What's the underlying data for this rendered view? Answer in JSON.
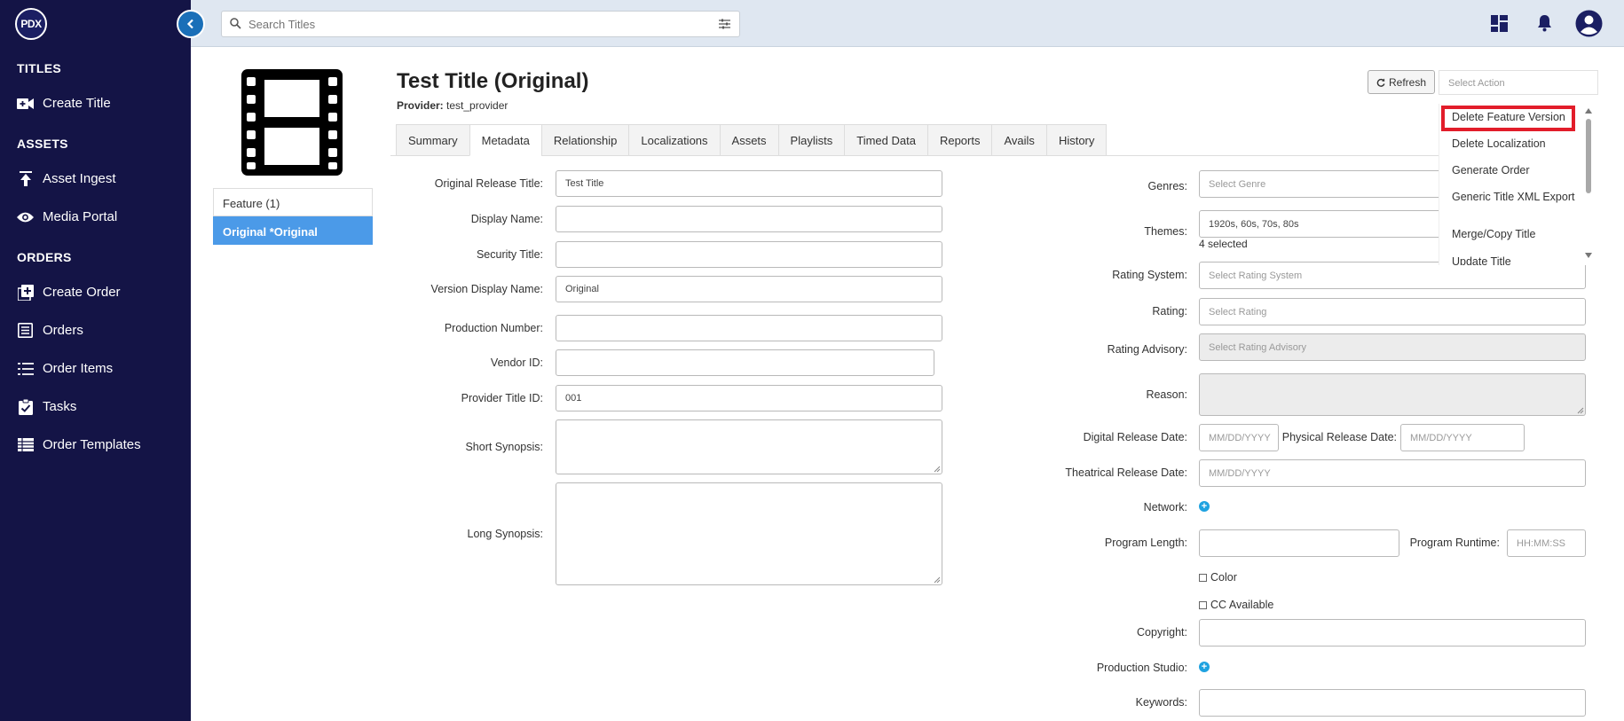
{
  "logo": "PDX",
  "sidebar": {
    "sections": [
      {
        "title": "TITLES",
        "items": [
          {
            "label": "Create Title",
            "icon": "video-add-icon"
          }
        ]
      },
      {
        "title": "ASSETS",
        "items": [
          {
            "label": "Asset Ingest",
            "icon": "upload-icon"
          },
          {
            "label": "Media Portal",
            "icon": "eye-icon"
          }
        ]
      },
      {
        "title": "ORDERS",
        "items": [
          {
            "label": "Create Order",
            "icon": "add-box-icon"
          },
          {
            "label": "Orders",
            "icon": "list-box-icon"
          },
          {
            "label": "Order Items",
            "icon": "list-icon"
          },
          {
            "label": "Tasks",
            "icon": "clipboard-check-icon"
          },
          {
            "label": "Order Templates",
            "icon": "table-icon"
          }
        ]
      }
    ]
  },
  "topbar": {
    "search_placeholder": "Search Titles"
  },
  "title": {
    "name": "Test Title (Original)",
    "provider_label": "Provider:",
    "provider_value": "test_provider"
  },
  "actions": {
    "refresh_label": "Refresh",
    "select_placeholder": "Select Action",
    "menu": [
      "Delete Feature Version",
      "Delete Localization",
      "Generate Order",
      "Generic Title XML Export",
      "Merge/Copy Title",
      "Update Title"
    ]
  },
  "versions": [
    {
      "label": "Feature (1)"
    },
    {
      "label": "Original *Original"
    }
  ],
  "tabs": [
    "Summary",
    "Metadata",
    "Relationship",
    "Localizations",
    "Assets",
    "Playlists",
    "Timed Data",
    "Reports",
    "Avails",
    "History"
  ],
  "active_tab": "Metadata",
  "left_form": {
    "original_release_title": {
      "label": "Original Release Title:",
      "value": "Test Title"
    },
    "display_name": {
      "label": "Display Name:",
      "value": ""
    },
    "security_title": {
      "label": "Security Title:",
      "value": ""
    },
    "version_display_name": {
      "label": "Version Display Name:",
      "value": "Original"
    },
    "production_number": {
      "label": "Production Number:",
      "value": ""
    },
    "vendor_id": {
      "label": "Vendor ID:",
      "value": ""
    },
    "provider_title_id": {
      "label": "Provider Title ID:",
      "value": "001"
    },
    "short_synopsis": {
      "label": "Short Synopsis:",
      "value": ""
    },
    "long_synopsis": {
      "label": "Long Synopsis:",
      "value": ""
    }
  },
  "right_form": {
    "genres": {
      "label": "Genres:",
      "placeholder": "Select Genre"
    },
    "themes": {
      "label": "Themes:",
      "value": "1920s, 60s, 70s, 80s",
      "count": "4 selected"
    },
    "rating_system": {
      "label": "Rating System:",
      "placeholder": "Select Rating System"
    },
    "rating": {
      "label": "Rating:",
      "placeholder": "Select Rating"
    },
    "rating_advisory": {
      "label": "Rating Advisory:",
      "placeholder": "Select Rating Advisory"
    },
    "reason": {
      "label": "Reason:"
    },
    "digital_release_date": {
      "label": "Digital Release Date:",
      "placeholder": "MM/DD/YYYY"
    },
    "physical_release_date": {
      "label": "Physical Release Date:",
      "placeholder": "MM/DD/YYYY"
    },
    "theatrical_release_date": {
      "label": "Theatrical Release Date:",
      "placeholder": "MM/DD/YYYY"
    },
    "network": {
      "label": "Network:"
    },
    "program_length": {
      "label": "Program Length:",
      "value": ""
    },
    "program_runtime": {
      "label": "Program Runtime:",
      "placeholder": "HH:MM:SS"
    },
    "color": {
      "label": "Color"
    },
    "cc_available": {
      "label": "CC Available"
    },
    "copyright": {
      "label": "Copyright:",
      "value": ""
    },
    "production_studio": {
      "label": "Production Studio:"
    },
    "keywords": {
      "label": "Keywords:",
      "value": ""
    }
  },
  "colors": {
    "sidebar": "#141446",
    "topbar": "#dfe7f1",
    "accent": "#4b9ae8",
    "highlight": "#e21d2a"
  }
}
